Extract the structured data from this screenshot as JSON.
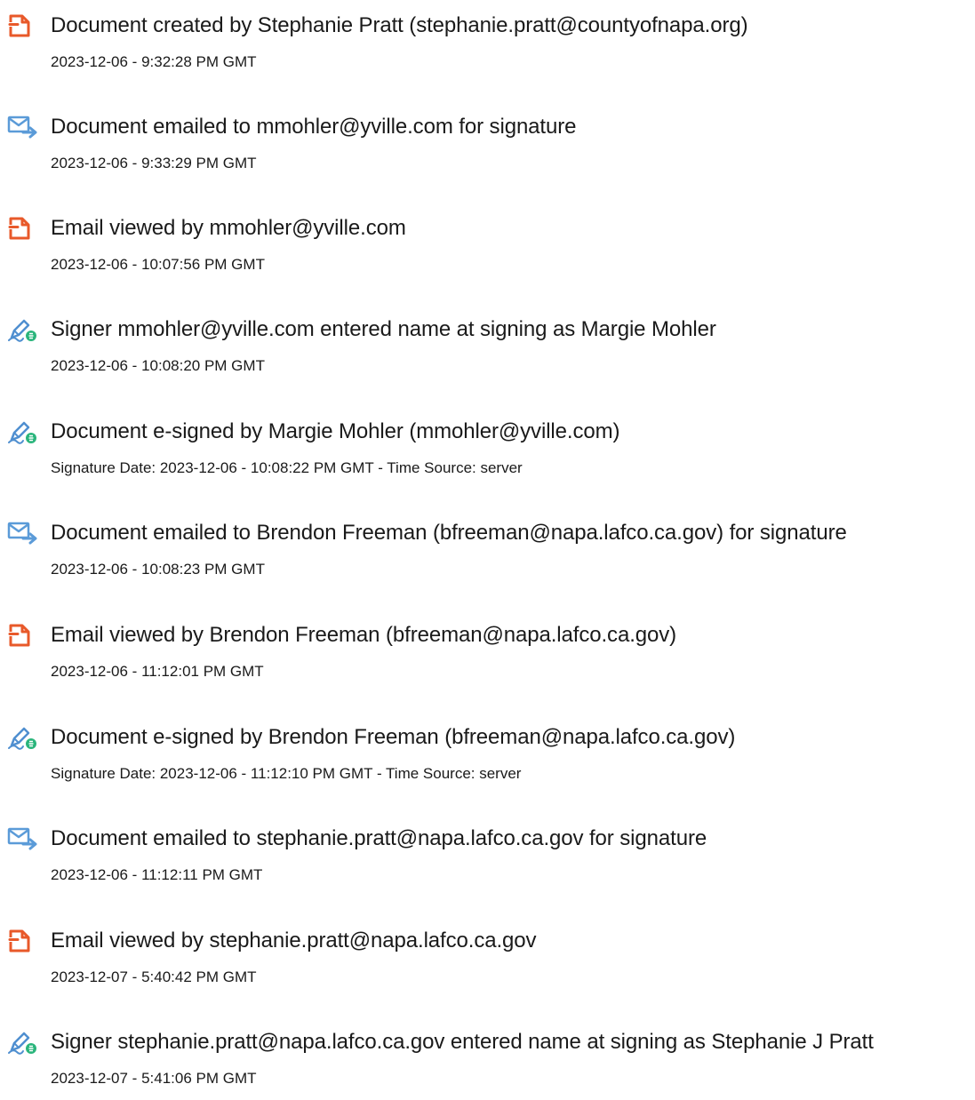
{
  "colors": {
    "doc_icon": "#e8592a",
    "email_icon": "#5b9bd8",
    "sign_icon": "#4f8fd0",
    "sign_badge": "#2bb57c"
  },
  "events": [
    {
      "icon": "document-created-icon",
      "title": "Document created by Stephanie Pratt (stephanie.pratt@countyofnapa.org)",
      "detail": "2023-12-06 - 9:32:28 PM GMT"
    },
    {
      "icon": "email-sent-icon",
      "title": "Document emailed to mmohler@yville.com for signature",
      "detail": "2023-12-06 - 9:33:29 PM GMT"
    },
    {
      "icon": "document-viewed-icon",
      "title": "Email viewed by mmohler@yville.com",
      "detail": "2023-12-06 - 10:07:56 PM GMT"
    },
    {
      "icon": "e-sign-icon",
      "title": "Signer mmohler@yville.com entered name at signing as Margie Mohler",
      "detail": "2023-12-06 - 10:08:20 PM GMT"
    },
    {
      "icon": "e-sign-icon",
      "title": "Document e-signed by Margie Mohler (mmohler@yville.com)",
      "detail": "Signature Date: 2023-12-06 - 10:08:22 PM GMT - Time Source: server"
    },
    {
      "icon": "email-sent-icon",
      "title": "Document emailed to Brendon Freeman (bfreeman@napa.lafco.ca.gov) for signature",
      "detail": "2023-12-06 - 10:08:23 PM GMT"
    },
    {
      "icon": "document-viewed-icon",
      "title": "Email viewed by Brendon Freeman (bfreeman@napa.lafco.ca.gov)",
      "detail": "2023-12-06 - 11:12:01 PM GMT"
    },
    {
      "icon": "e-sign-icon",
      "title": "Document e-signed by Brendon Freeman (bfreeman@napa.lafco.ca.gov)",
      "detail": "Signature Date: 2023-12-06 - 11:12:10 PM GMT - Time Source: server"
    },
    {
      "icon": "email-sent-icon",
      "title": "Document emailed to stephanie.pratt@napa.lafco.ca.gov for signature",
      "detail": "2023-12-06 - 11:12:11 PM GMT"
    },
    {
      "icon": "document-viewed-icon",
      "title": "Email viewed by stephanie.pratt@napa.lafco.ca.gov",
      "detail": "2023-12-07 - 5:40:42 PM GMT"
    },
    {
      "icon": "e-sign-icon",
      "title": "Signer stephanie.pratt@napa.lafco.ca.gov entered name at signing as Stephanie J Pratt",
      "detail": "2023-12-07 - 5:41:06 PM GMT"
    }
  ]
}
